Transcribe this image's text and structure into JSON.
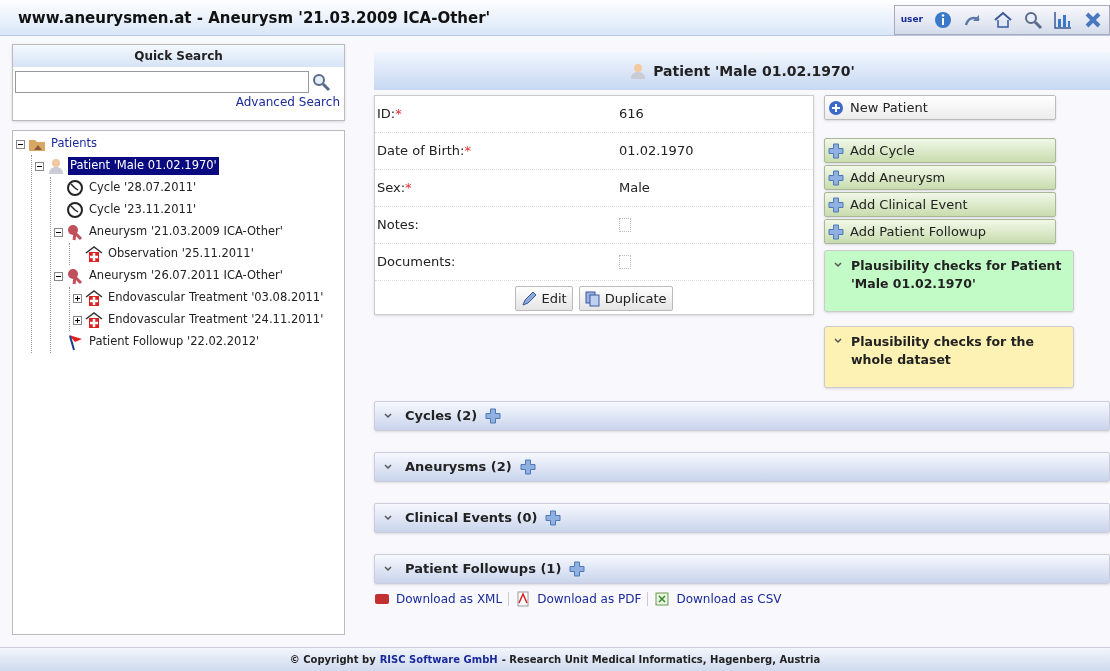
{
  "window": {
    "title": "www.aneurysmen.at - Aneurysm '21.03.2009 ICA-Other'"
  },
  "toolbar": {
    "user_label": "user"
  },
  "quick_search": {
    "title": "Quick Search",
    "advanced_link": "Advanced Search"
  },
  "tree": [
    {
      "label": "Patients",
      "kind": "folder",
      "expanded": true,
      "selected": false,
      "children": [
        {
          "label": "Patient 'Male 01.02.1970'",
          "kind": "person",
          "expanded": true,
          "selected": true,
          "children": [
            {
              "label": "Cycle '28.07.2011'",
              "kind": "clock",
              "selected": false
            },
            {
              "label": "Cycle '23.11.2011'",
              "kind": "clock",
              "selected": false
            },
            {
              "label": "Aneurysm '21.03.2009 ICA-Other'",
              "kind": "aneurysm",
              "expanded": true,
              "selected": false,
              "children": [
                {
                  "label": "Observation '25.11.2011'",
                  "kind": "hospital",
                  "selected": false
                }
              ]
            },
            {
              "label": "Aneurysm '26.07.2011 ICA-Other'",
              "kind": "aneurysm",
              "expanded": true,
              "selected": false,
              "children": [
                {
                  "label": "Endovascular Treatment '03.08.2011'",
                  "kind": "hospital",
                  "expanded": false,
                  "selected": false
                },
                {
                  "label": "Endovascular Treatment '24.11.2011'",
                  "kind": "hospital",
                  "expanded": false,
                  "selected": false
                }
              ]
            },
            {
              "label": "Patient Followup '22.02.2012'",
              "kind": "flag",
              "selected": false
            }
          ]
        }
      ]
    }
  ],
  "patient": {
    "title": "Patient 'Male 01.02.1970'",
    "fields": [
      {
        "label": "ID:",
        "required_mark": "*",
        "value": "616"
      },
      {
        "label": "Date of Birth:",
        "required_mark": "*",
        "value": "01.02.1970"
      },
      {
        "label": "Sex:",
        "required_mark": "*",
        "value": "Male"
      },
      {
        "label": "Notes:"
      },
      {
        "label": "Documents:"
      }
    ],
    "form_buttons": [
      {
        "label": "Edit",
        "kind": "edit"
      },
      {
        "label": "Duplicate",
        "kind": "duplicate"
      }
    ],
    "actions": [
      {
        "label": "New Patient",
        "kind": "new"
      },
      {
        "label": "Add Cycle",
        "kind": "add"
      },
      {
        "label": "Add Aneurysm",
        "kind": "add"
      },
      {
        "label": "Add Clinical Event",
        "kind": "add"
      },
      {
        "label": "Add Patient Followup",
        "kind": "add"
      }
    ],
    "checks": [
      {
        "title": "Plausibility checks for Patient 'Male 01.02.1970'",
        "color": "#c3fbc7"
      },
      {
        "title": "Plausibility checks for the whole dataset",
        "color": "#fdf1b3"
      }
    ],
    "sections": [
      {
        "title": "Cycles (2)"
      },
      {
        "title": "Aneurysms (2)"
      },
      {
        "title": "Clinical Events (0)"
      },
      {
        "title": "Patient Followups (1)"
      }
    ],
    "downloads": [
      {
        "label": "Download as XML",
        "kind": "xml"
      },
      {
        "label": "Download as PDF",
        "kind": "pdf"
      },
      {
        "label": "Download as CSV",
        "kind": "csv"
      }
    ]
  },
  "footer": {
    "prefix": "© Copyright by",
    "link": "RISC Software GmbH",
    "suffix": "- Research Unit Medical Informatics, Hagenberg, Austria"
  }
}
